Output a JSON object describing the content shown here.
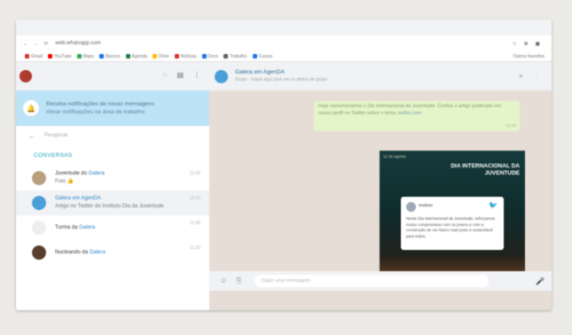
{
  "browser": {
    "nav_icons": "← → ⟳",
    "url": "web.whatsapp.com",
    "ext_icons": "☆ ⊕ ▣",
    "bookmarks": [
      {
        "label": "Gmail",
        "color": "#d93025"
      },
      {
        "label": "YouTube",
        "color": "#ff0000"
      },
      {
        "label": "Maps",
        "color": "#34a853"
      },
      {
        "label": "Bancos",
        "color": "#1a73e8"
      },
      {
        "label": "Agenda",
        "color": "#188038"
      },
      {
        "label": "Drive",
        "color": "#fbbc04"
      },
      {
        "label": "Notícias",
        "color": "#d93025"
      },
      {
        "label": "Docs",
        "color": "#1a73e8"
      },
      {
        "label": "Trabalho",
        "color": "#5f6368"
      },
      {
        "label": "Cursos",
        "color": "#1a73e8"
      }
    ],
    "other_bookmarks": "Outros favoritos"
  },
  "sidebar": {
    "icons": [
      "◌",
      "▤",
      "⋮"
    ],
    "notification": {
      "title": "Receba notificações de novas mensagens",
      "subtitle": "Ativar notificações na área de trabalho"
    },
    "search_label": "Pesquisar",
    "section_label": "CONVERSAS",
    "chats": [
      {
        "prefix": "Juventude do",
        "highlight": "Galera",
        "preview": "Foto 👍",
        "time": "12:40",
        "avatar_color": "#b8a07e"
      },
      {
        "prefix": "",
        "highlight": "Galera em AgenDA",
        "preview": "Artigo no Twitter do Instituto Dia da Juventude",
        "time": "12:10",
        "avatar_color": "#4a9fd8"
      },
      {
        "prefix": "Turma da",
        "highlight": "Galera",
        "preview": "",
        "time": "11:58",
        "avatar_color": "#eeeeee"
      },
      {
        "prefix": "Nucleando da",
        "highlight": "Galera",
        "preview": "",
        "time": "11:20",
        "avatar_color": "#5a3d2e"
      }
    ]
  },
  "chat": {
    "title": "Galera em AgenDA",
    "subtitle": "Grupo · toque aqui para ver os dados do grupo",
    "header_icons": "⌕ ⋮",
    "message": {
      "text": "Hoje comemoramos o Dia Internacional da Juventude. Confira o artigo publicado em nosso perfil no Twitter sobre o tema.",
      "link": "twitter.com",
      "time": "12:10"
    },
    "image": {
      "caption": "12 de agosto",
      "title": "DIA INTERNACIONAL DA JUVENTUDE",
      "tweet_name": "Instituto",
      "tweet_text": "Neste Dia Internacional da Juventude, reforçamos nosso compromisso com os jovens e com a construção de um futuro mais justo e sustentável para todos."
    },
    "input_icons": "☺ ⎘",
    "input_placeholder": "Digite uma mensagem",
    "mic_icon": "🎤"
  }
}
